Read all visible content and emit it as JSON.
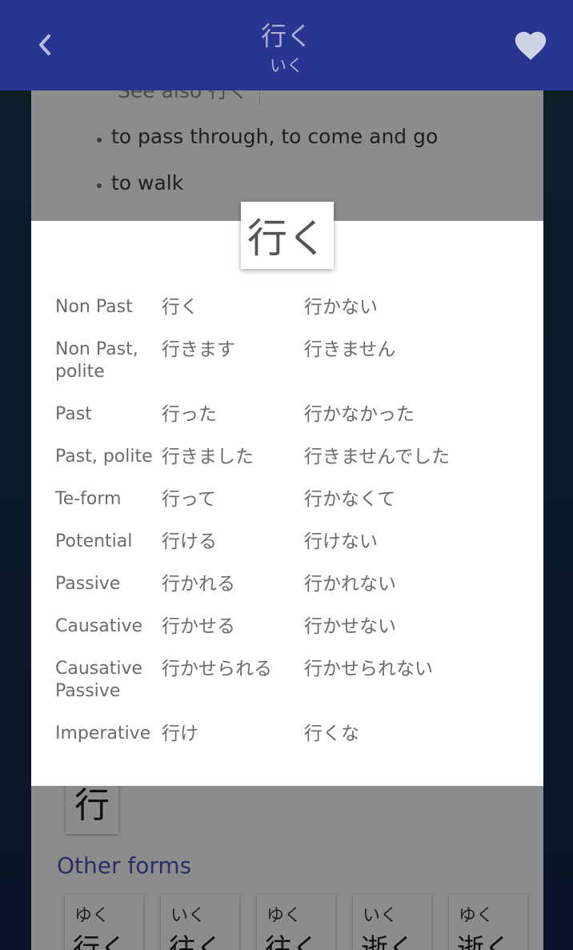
{
  "header": {
    "title": "行く",
    "reading": "いく",
    "back_icon": "chevron-left-icon",
    "favorite_icon": "heart-icon"
  },
  "background": {
    "partial_gloss": "See also 行く",
    "glosses": [
      "to pass through, to come and go",
      "to walk"
    ],
    "kanji_tile": "行",
    "other_forms_heading": "Other forms",
    "other_forms": [
      {
        "reading": "ゆく",
        "word": "行く"
      },
      {
        "reading": "いく",
        "word": "往く"
      },
      {
        "reading": "ゆく",
        "word": "往く"
      },
      {
        "reading": "いく",
        "word": "逝く"
      },
      {
        "reading": "ゆく",
        "word": "逝く"
      }
    ]
  },
  "dialog": {
    "word": "行く",
    "rows": [
      {
        "label": "Non Past",
        "positive": "行く",
        "negative": "行かない"
      },
      {
        "label": "Non Past, polite",
        "positive": "行きます",
        "negative": "行きません"
      },
      {
        "label": "Past",
        "positive": "行った",
        "negative": "行かなかった"
      },
      {
        "label": "Past, polite",
        "positive": "行きました",
        "negative": "行きませんでした"
      },
      {
        "label": "Te-form",
        "positive": "行って",
        "negative": "行かなくて"
      },
      {
        "label": "Potential",
        "positive": "行ける",
        "negative": "行けない"
      },
      {
        "label": "Passive",
        "positive": "行かれる",
        "negative": "行かれない"
      },
      {
        "label": "Causative",
        "positive": "行かせる",
        "negative": "行かせない"
      },
      {
        "label": "Causative Passive",
        "positive": "行かせられる",
        "negative": "行かせられない"
      },
      {
        "label": "Imperative",
        "positive": "行け",
        "negative": "行くな"
      }
    ]
  },
  "colors": {
    "header": "#283591",
    "accent": "#4a56b8",
    "scrim": "rgba(0,0,0,0.45)"
  }
}
